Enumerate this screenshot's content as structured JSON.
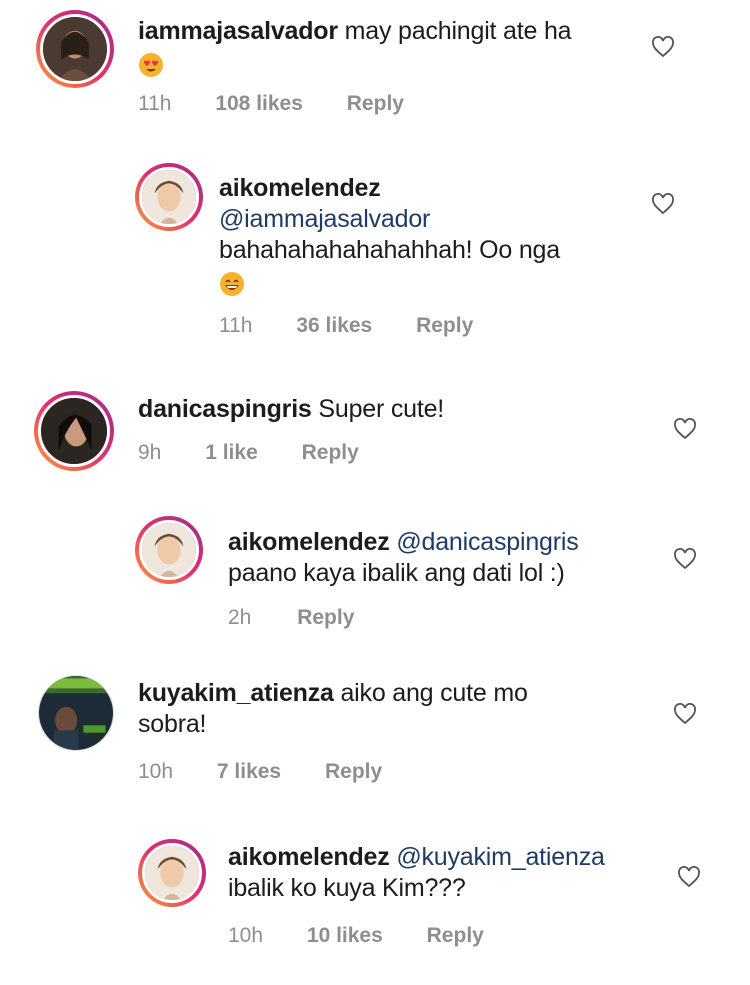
{
  "comments": [
    {
      "username": "iammajasalvador",
      "text": "may pachingit ate ha",
      "emoji": "heart-eyes-emoji",
      "time": "11h",
      "likes": "108 likes",
      "reply": "Reply"
    },
    {
      "username": "aikomelendez",
      "mention": "@iammajasalvador",
      "text": "bahahahahahahahhah! Oo nga",
      "emoji": "grinning-emoji",
      "time": "11h",
      "likes": "36 likes",
      "reply": "Reply"
    },
    {
      "username": "danicaspingris",
      "text": "Super cute!",
      "time": "9h",
      "likes": "1 like",
      "reply": "Reply"
    },
    {
      "username": "aikomelendez",
      "mention": "@danicaspingris",
      "text": "paano kaya ibalik ang dati lol :)",
      "time": "2h",
      "reply": "Reply"
    },
    {
      "username": "kuyakim_atienza",
      "text": "aiko ang cute mo",
      "text2": "sobra!",
      "time": "10h",
      "likes": "7 likes",
      "reply": "Reply"
    },
    {
      "username": "aikomelendez",
      "mention": "@kuyakim_atienza",
      "text": "ibalik ko kuya Kim???",
      "time": "10h",
      "likes": "10 likes",
      "reply": "Reply"
    }
  ],
  "icons": {
    "like": "heart-outline-icon"
  },
  "colors": {
    "meta": "#8e8e8e",
    "mention": "#1f3b63",
    "ring_start": "#f9a23a",
    "ring_end": "#9b2c8f"
  }
}
